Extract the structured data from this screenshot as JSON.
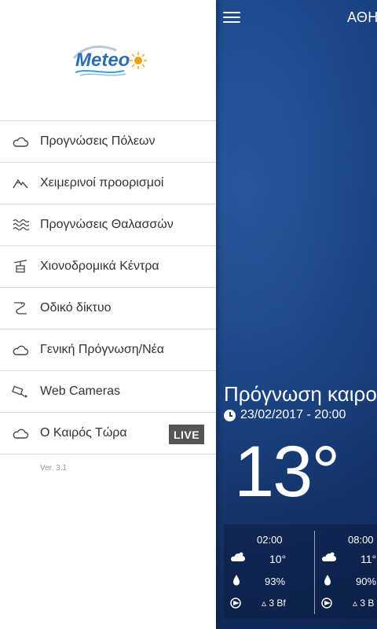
{
  "app": {
    "city": "ΑΘΗ",
    "forecast_title": "Πρόγνωση καιρο",
    "forecast_date": "23/02/2017 - 20:00",
    "current_temp": "13°",
    "hourly": [
      {
        "time": "02:00",
        "temp": "10°",
        "humidity": "93%",
        "wind": "3 Bf"
      },
      {
        "time": "08:00",
        "temp": "11°",
        "humidity": "90%",
        "wind": "3 B"
      }
    ]
  },
  "drawer": {
    "logo_text": "Meteo",
    "items": [
      {
        "label": "Προγνώσεις Πόλεων",
        "icon": "cloud-icon"
      },
      {
        "label": "Χειμερινοί προορισμοί",
        "icon": "mountain-icon"
      },
      {
        "label": "Προγνώσεις Θαλασσών",
        "icon": "waves-icon"
      },
      {
        "label": "Χιονοδρομικά Κέντρα",
        "icon": "ski-lift-icon"
      },
      {
        "label": "Οδικό δίκτυο",
        "icon": "road-icon"
      },
      {
        "label": "Γενική Πρόγνωση/Νέα",
        "icon": "cloud-icon"
      },
      {
        "label": "Web Cameras",
        "icon": "camera-icon"
      },
      {
        "label": "Ο Καιρός Τώρα",
        "icon": "cloud-icon",
        "badge": "LIVE"
      }
    ],
    "version": "Ver. 3.1"
  },
  "colors": {
    "background_blue": "#1b3f7a",
    "live_badge": "#555555",
    "divider": "#dcdcdc",
    "logo_blue": "#2a6db5",
    "logo_sun": "#f2a21a"
  }
}
